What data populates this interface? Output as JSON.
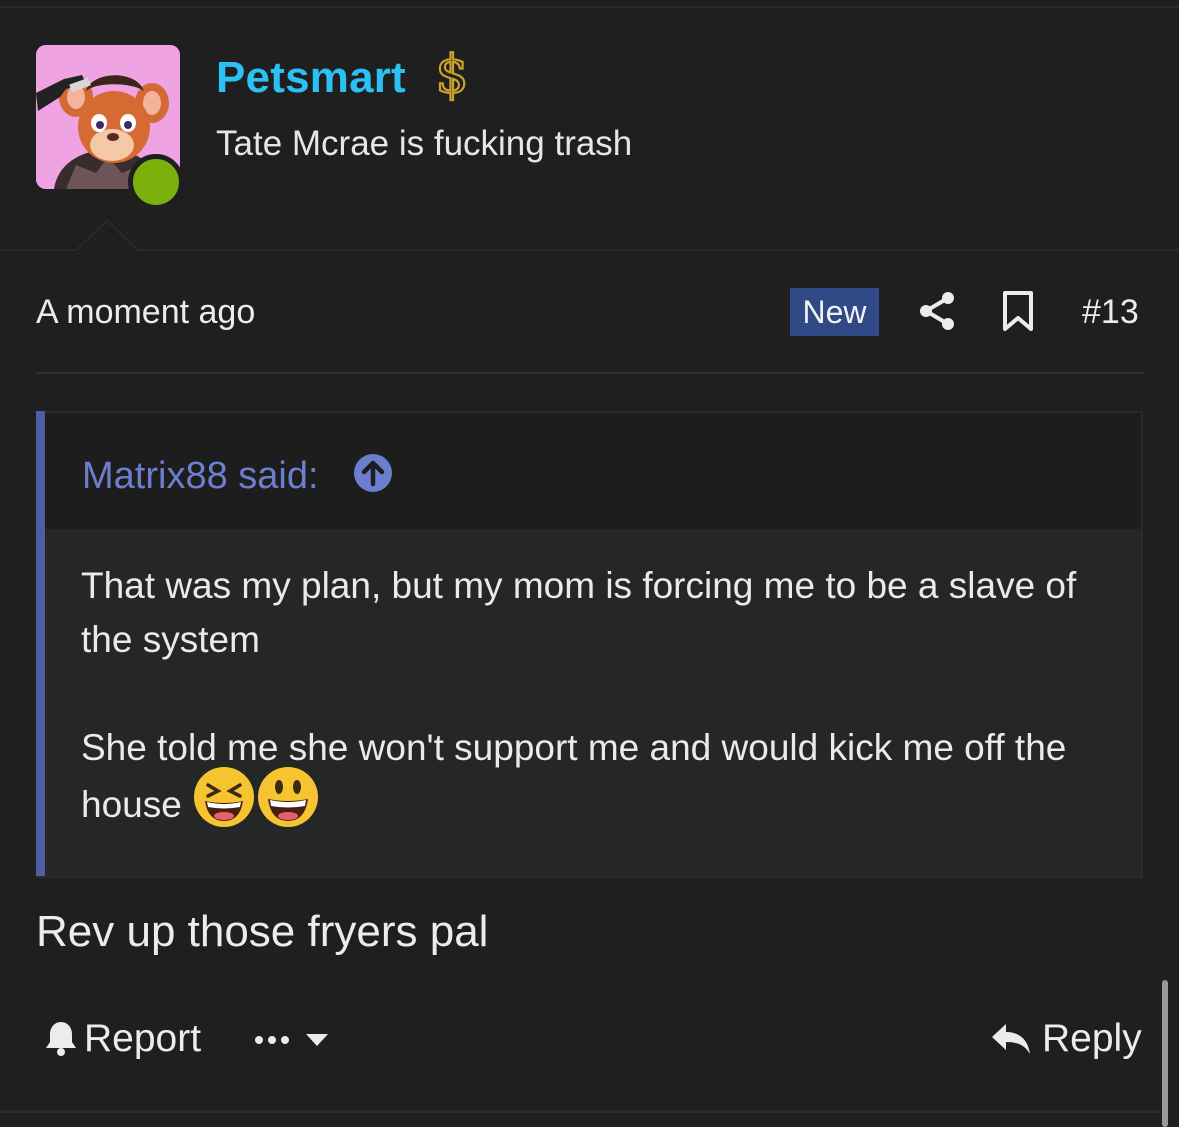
{
  "post": {
    "author": {
      "username": "Petsmart",
      "user_title": "Tate Mcrae is fucking trash",
      "username_color": "#2cc1f5",
      "online_color": "#7cb10c",
      "badge_icon": "dollar-icon"
    },
    "meta": {
      "timestamp": "A moment ago",
      "new_label": "New",
      "post_number": "#13",
      "share_icon": "share-icon",
      "bookmark_icon": "bookmark-icon"
    },
    "quote": {
      "author_line": "Matrix88 said:",
      "up_icon": "arrow-up-circle-icon",
      "paragraph1": "That was my plan, but my mom is forcing me to be a slave of the system",
      "paragraph2": "She told me she won't support me and would kick me off the house",
      "emojis": [
        "squinting-laughing-emoji",
        "grinning-emoji"
      ],
      "accent_color": "#4e5da6"
    },
    "body": "Rev up those fryers pal",
    "footer": {
      "report_label": "Report",
      "reply_label": "Reply",
      "more_icon": "more-dots-icon"
    }
  }
}
